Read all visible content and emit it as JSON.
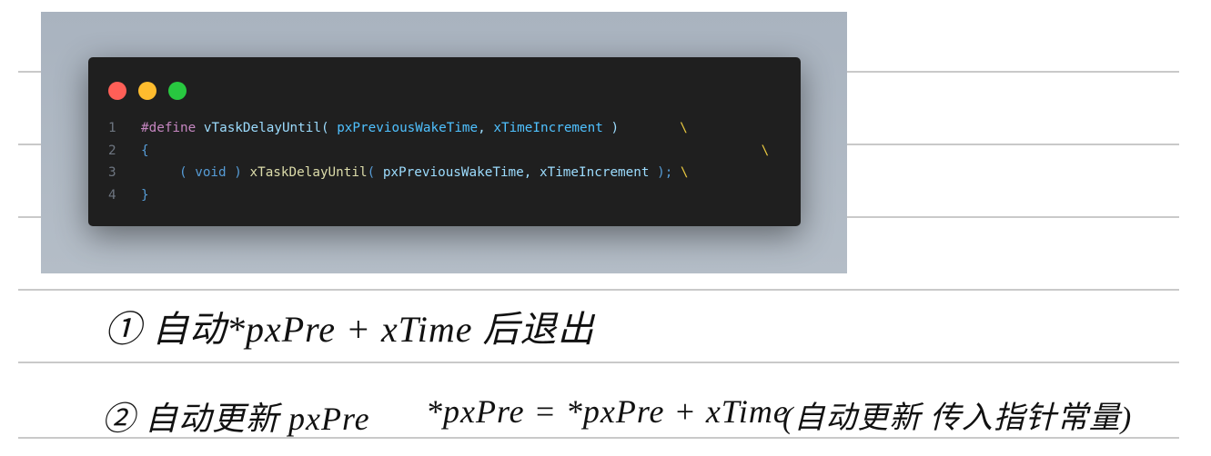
{
  "top_scribble": "",
  "note_line_1": "① 自动*pxPre + xTime 后退出",
  "note_line_2_left": "② 自动更新 pxPre",
  "note_line_2_mid": "*pxPre = *pxPre + xTime",
  "note_line_2_right": "(自动更新 传入指针常量)",
  "code_lines": [
    {
      "n": "1",
      "a": "#define",
      "b": " vTaskDelayUntil( ",
      "c": "pxPreviousWakeTime",
      ",": ", ",
      "d": "xTimeIncrement",
      "e": " )",
      "bs": "\\"
    },
    {
      "n": "2",
      "a": "{",
      "bs": "\\"
    },
    {
      "n": "3",
      "a": "( void )",
      "b": " xTaskDelayUntil",
      "c": "( ",
      "d": "pxPreviousWakeTime, xTimeIncrement",
      "e": " ); ",
      "bs": "\\"
    },
    {
      "n": "4",
      "a": "}"
    }
  ],
  "window_dots": {
    "red": "#ff5f57",
    "yellow": "#febc2e",
    "green": "#28c840"
  }
}
